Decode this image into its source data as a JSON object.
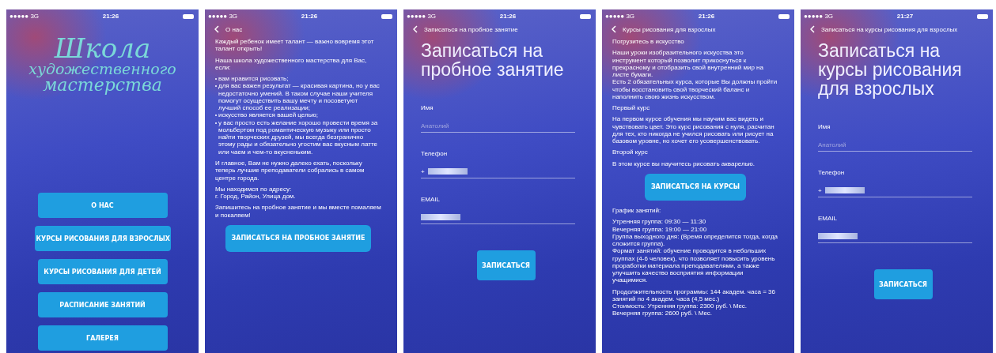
{
  "screens": [
    {
      "kind": "menu",
      "status": {
        "signal": "●●●●● 3G",
        "time": "21:26"
      },
      "logo": [
        "Школа",
        "художественного",
        "мастерства"
      ],
      "buttons": [
        "О НАС",
        "КУРСЫ РИСОВАНИЯ ДЛЯ ВЗРОСЛЫХ",
        "КУРСЫ РИСОВАНИЯ ДЛЯ ДЕТЕЙ",
        "РАСПИСАНИЕ ЗАНЯТИЙ",
        "ГАЛЕРЕЯ"
      ]
    },
    {
      "kind": "text",
      "status": {
        "signal": "●●●●● 3G",
        "time": "21:26"
      },
      "nav_title": "О нас",
      "blocks": [
        {
          "kind": "para",
          "text": "Каждый ребенок имеет талант — важно вовремя этот талант открыть!"
        },
        {
          "kind": "para",
          "text": "Наша школа художественного мастерства для Вас, если:"
        },
        {
          "kind": "list",
          "items": [
            "вам нравится рисовать;",
            "для вас важен результат — красивая картина, но у вас недостаточно умений. В таком случае наши учителя помогут осуществить вашу мечту и посоветуют лучший способ ее реализации;",
            "искусство является вашей целью;",
            "у вас просто есть желание хорошо провести время за мольбертом под романтическую музыку или просто найти творческих друзей, мы всегда безгранично этому рады и обязательно угостим вас вкусным латте или чаем и чем-то вкусненьким."
          ]
        },
        {
          "kind": "para",
          "text": "И главное, Вам не нужно далеко ехать, поскольку теперь лучшие преподаватели собрались в самом центре города."
        },
        {
          "kind": "lines",
          "lines": [
            "Мы находимся по адресу:",
            "г. Город, Район, Улица дом."
          ]
        },
        {
          "kind": "para",
          "text": "Запишитесь на пробное занятие и мы вместе помаляем и покаляем!"
        },
        {
          "kind": "button",
          "text": "ЗАПИСАТЬСЯ НА ПРОБНОЕ ЗАНЯТИЕ"
        }
      ]
    },
    {
      "kind": "form",
      "status": {
        "signal": "●●●●● 3G",
        "time": "21:26"
      },
      "nav_title": "Записаться на пробное занятие",
      "heading": "Записаться на пробное занятие",
      "fields": [
        {
          "label": "Имя",
          "placeholder": "Анатолий",
          "redacted": false
        },
        {
          "label": "Телефон",
          "value": "+",
          "redacted": true
        },
        {
          "label": "EMAIL",
          "redacted": true
        }
      ],
      "submit": "ЗАПИСАТЬСЯ"
    },
    {
      "kind": "text",
      "status": {
        "signal": "●●●●● 3G",
        "time": "21:26"
      },
      "nav_title": "Курсы рисования для взрослых",
      "blocks": [
        {
          "kind": "para",
          "text": "Погрузитесь в искусство"
        },
        {
          "kind": "lines",
          "lines": [
            "Наши уроки изобразительного искусства это инструмент который позволит прикоснуться к прекрасному и отобразить свой внутренний мир на листе бумаги.",
            "Есть 2 обязательных курса, которые Вы должны пройти чтобы восстановить свой творческий баланс и наполнить свою жизнь искусством."
          ]
        },
        {
          "kind": "para",
          "text": "Первый курс"
        },
        {
          "kind": "para",
          "text": "На первом курсе обучения мы научим вас видеть и чувствовать цвет. Это курс рисования с нуля, расчитан для тех, кто никогда не учился рисовать или рисует на базовом уровне, но хочет его усовершенствовать."
        },
        {
          "kind": "para",
          "text": "Второй курс"
        },
        {
          "kind": "para",
          "text": "В этом курсе вы научитесь рисовать акварелью."
        },
        {
          "kind": "button",
          "text": "ЗАПИСАТЬСЯ НА КУРСЫ"
        },
        {
          "kind": "para",
          "text": "График занятий:"
        },
        {
          "kind": "lines",
          "lines": [
            "Утренняя группа: 09:30 — 11:30",
            "Вечерняя группа: 19:00 — 21:00",
            "Группа выходного дня: (Время определится тогда, когда сложится группа).",
            "Формат занятий: обучение проводится в небольших группах (4-6 человек), что позволяет повысить уровень проработки материала преподавателями, а также улучшить качество восприятия информации учащимися."
          ]
        },
        {
          "kind": "lines",
          "lines": [
            "Продолжительность программы: 144 академ. часа = 36 занятий по 4 академ. часа (4,5 мес.)",
            "Стоимость: Утренняя группа: 2300 руб. \\ Мес.",
            "Вечерняя группа: 2600 руб. \\ Мес."
          ]
        }
      ]
    },
    {
      "kind": "form",
      "status": {
        "signal": "●●●●● 3G",
        "time": "21:27"
      },
      "nav_title": "Записаться на курсы рисования для взрослых",
      "heading": "Записаться на курсы рисования для взрослых",
      "fields": [
        {
          "label": "Имя",
          "placeholder": "Анатолий",
          "redacted": false
        },
        {
          "label": "Телефон",
          "value": "+",
          "redacted": true
        },
        {
          "label": "EMAIL",
          "redacted": true
        }
      ],
      "submit": "ЗАПИСАТЬСЯ"
    }
  ]
}
